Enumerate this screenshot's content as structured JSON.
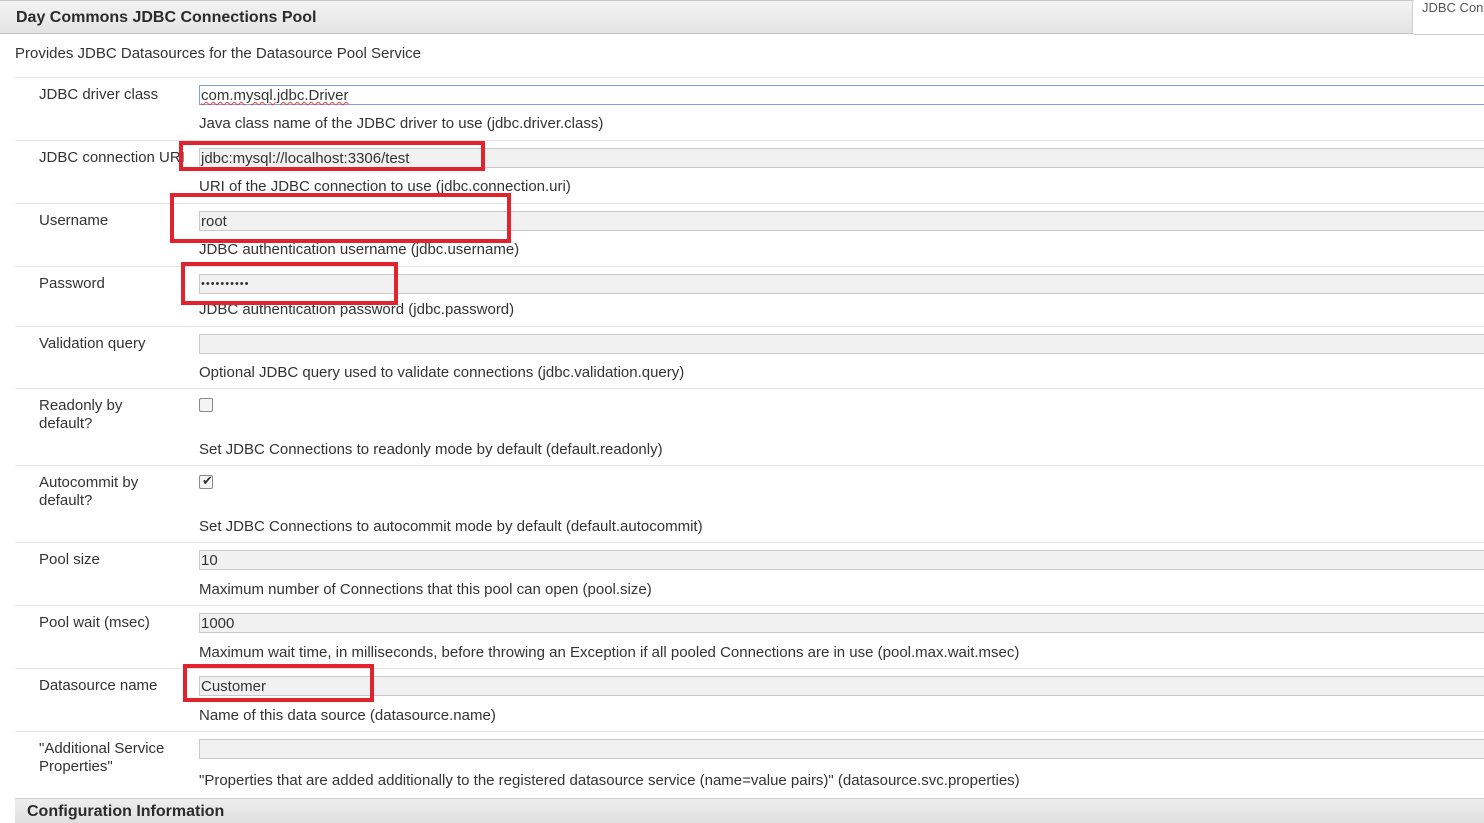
{
  "dialog": {
    "title": "Day Commons JDBC Connections Pool",
    "side_tab": "JDBC Con",
    "description": "Provides JDBC Datasources for the Datasource Pool Service"
  },
  "fields": [
    {
      "label": "JDBC driver class",
      "value": "com.mysql.jdbc.Driver",
      "description": "Java class name of the JDBC driver to use (jdbc.driver.class)"
    },
    {
      "label": "JDBC connection URI",
      "value": "jdbc:mysql://localhost:3306/test",
      "description": "URI of the JDBC connection to use (jdbc.connection.uri)"
    },
    {
      "label": "Username",
      "value": "root",
      "description": "JDBC authentication username (jdbc.username)"
    },
    {
      "label": "Password",
      "value": "••••••••••",
      "description": "JDBC authentication password (jdbc.password)"
    },
    {
      "label": "Validation query",
      "value": "",
      "description": "Optional JDBC query used to validate connections (jdbc.validation.query)"
    },
    {
      "label": "Readonly by default?",
      "checked": false,
      "description": "Set JDBC Connections to readonly mode by default (default.readonly)"
    },
    {
      "label": "Autocommit by default?",
      "checked": true,
      "check_glyph": "✔",
      "description": "Set JDBC Connections to autocommit mode by default (default.autocommit)"
    },
    {
      "label": "Pool size",
      "value": "10",
      "description": "Maximum number of Connections that this pool can open (pool.size)"
    },
    {
      "label": "Pool wait (msec)",
      "value": "1000",
      "description": "Maximum wait time, in milliseconds, before throwing an Exception if all pooled Connections are in use (pool.max.wait.msec)"
    },
    {
      "label": "Datasource name",
      "value": "Customer",
      "description": "Name of this data source (datasource.name)"
    },
    {
      "label": "\"Additional Service Properties\"",
      "value": "",
      "description": "\"Properties that are added additionally to the registered datasource service (name=value pairs)\" (datasource.svc.properties)"
    }
  ],
  "footer": {
    "title": "Configuration Information"
  },
  "colors": {
    "highlight": "#e0232e",
    "header_bg": "#e8e8e8",
    "input_bg": "#f1f1f1"
  }
}
